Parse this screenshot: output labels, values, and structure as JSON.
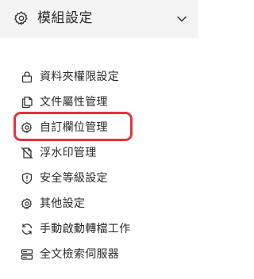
{
  "header": {
    "title": "模組設定",
    "icon": "gear-icon",
    "chevron": "chevron-down-icon",
    "background": "#f4f4f4"
  },
  "menu": {
    "items": [
      {
        "label": "資料夾權限設定",
        "icon": "lock-icon"
      },
      {
        "label": "文件屬性管理",
        "icon": "documents-icon"
      },
      {
        "label": "自訂欄位管理",
        "icon": "gear-icon",
        "highlighted": true
      },
      {
        "label": "浮水印管理",
        "icon": "watermark-icon"
      },
      {
        "label": "安全等級設定",
        "icon": "shield-icon"
      },
      {
        "label": "其他設定",
        "icon": "gear-icon"
      },
      {
        "label": "手動啟動轉檔工作",
        "icon": "refresh-icon"
      },
      {
        "label": "全文檢索伺服器",
        "icon": "server-icon"
      }
    ]
  },
  "highlight_color": "#e8313f"
}
